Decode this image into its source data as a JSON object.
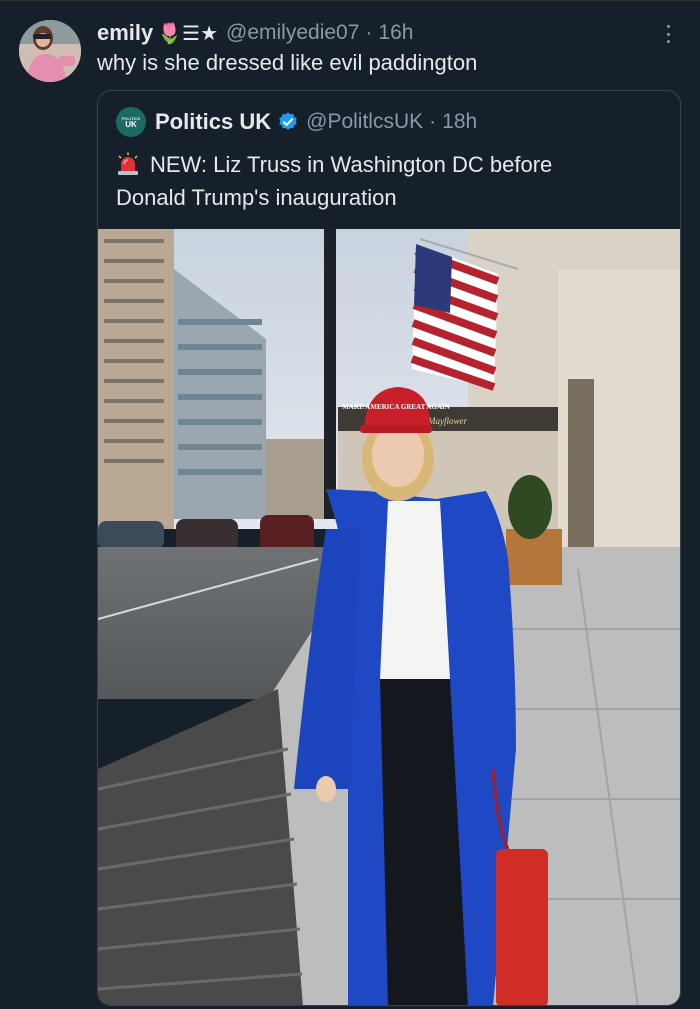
{
  "tweet": {
    "author_name": "emily",
    "author_emoji": "🌷☰★",
    "handle": "@emilyedie07",
    "separator": "·",
    "time": "16h",
    "text": "why is she dressed like evil paddington"
  },
  "quoted_tweet": {
    "avatar_text": "UK",
    "avatar_small": "POLITICS",
    "author_name": "Politics UK",
    "handle": "@PolitlcsUK",
    "separator": "·",
    "time": "18h",
    "text_line1": "NEW: Liz Truss in Washington DC before",
    "text_line2": "Donald Trump's inauguration",
    "image_hat_text": "MAKE AMERICA GREAT AGAIN",
    "image_sign_text": "Mayflower"
  },
  "colors": {
    "background": "#15202b",
    "text": "#e7e9ea",
    "secondary_text": "#8b98a5",
    "border": "#38444d",
    "verified": "#1d9bf0"
  },
  "icons": {
    "more": "more-icon",
    "verified": "verified-badge-icon",
    "siren": "rotating-light-icon"
  }
}
